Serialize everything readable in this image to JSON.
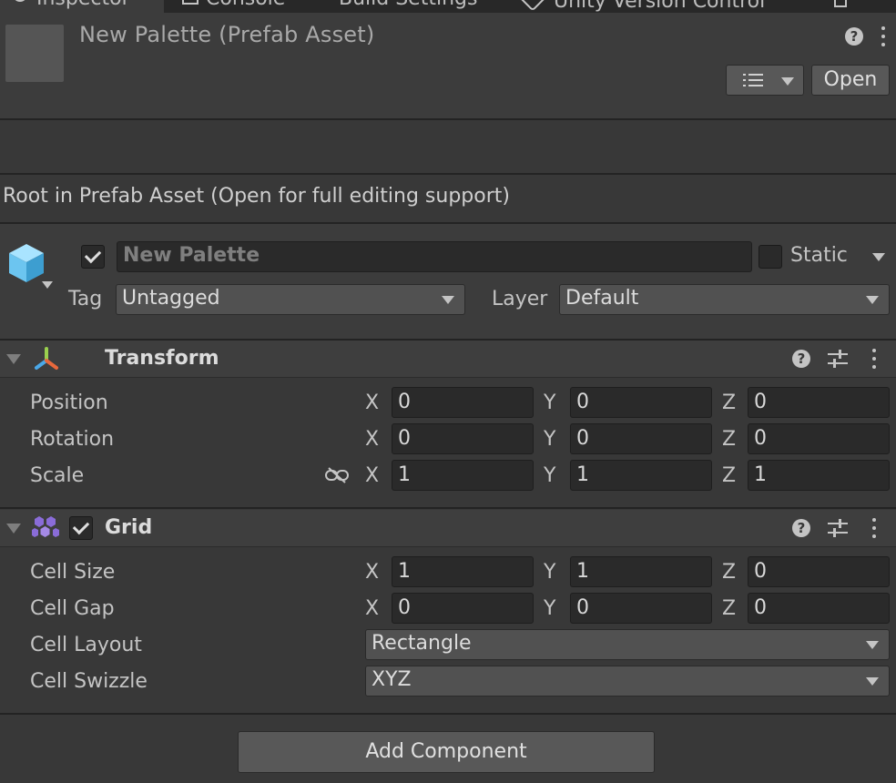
{
  "tabs": [
    {
      "label": "Inspector",
      "active": true
    },
    {
      "label": "Console"
    },
    {
      "label": "Build Settings"
    },
    {
      "label": "Unity Version Control"
    }
  ],
  "header": {
    "title": "New Palette (Prefab Asset)",
    "open_label": "Open",
    "help_glyph": "?"
  },
  "info": "Root in Prefab Asset (Open for full editing support)",
  "gameobject": {
    "active": true,
    "name": "New Palette",
    "static_label": "Static",
    "static": false,
    "tag_label": "Tag",
    "tag_value": "Untagged",
    "layer_label": "Layer",
    "layer_value": "Default"
  },
  "transform": {
    "title": "Transform",
    "rows": [
      {
        "label": "Position",
        "x": "0",
        "y": "0",
        "z": "0"
      },
      {
        "label": "Rotation",
        "x": "0",
        "y": "0",
        "z": "0"
      },
      {
        "label": "Scale",
        "x": "1",
        "y": "1",
        "z": "1"
      }
    ]
  },
  "grid": {
    "title": "Grid",
    "enabled": true,
    "rows": [
      {
        "label": "Cell Size",
        "x": "1",
        "y": "1",
        "z": "0"
      },
      {
        "label": "Cell Gap",
        "x": "0",
        "y": "0",
        "z": "0"
      }
    ],
    "cell_layout_label": "Cell Layout",
    "cell_layout_value": "Rectangle",
    "cell_swizzle_label": "Cell Swizzle",
    "cell_swizzle_value": "XYZ"
  },
  "axes": {
    "x": "X",
    "y": "Y",
    "z": "Z"
  },
  "add_component_label": "Add Component",
  "colors": {
    "panel": "#383838",
    "header": "#3c3c3c",
    "field": "#2a2a2a",
    "cube": "#6cc5f0",
    "grid_icon": "#8a6cd8"
  }
}
